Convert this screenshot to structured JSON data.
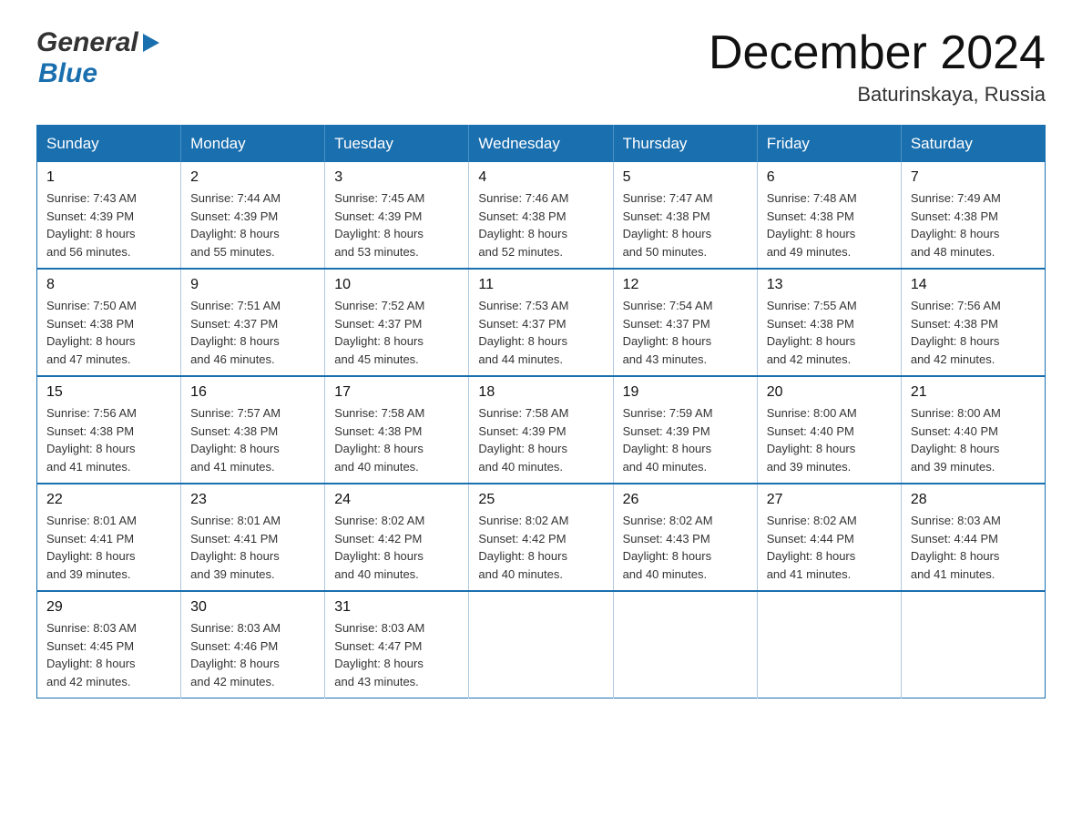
{
  "header": {
    "logo_general": "General",
    "logo_blue": "Blue",
    "month_title": "December 2024",
    "location": "Baturinskaya, Russia"
  },
  "days_of_week": [
    "Sunday",
    "Monday",
    "Tuesday",
    "Wednesday",
    "Thursday",
    "Friday",
    "Saturday"
  ],
  "weeks": [
    [
      {
        "day": "1",
        "sunrise": "7:43 AM",
        "sunset": "4:39 PM",
        "daylight": "8 hours and 56 minutes."
      },
      {
        "day": "2",
        "sunrise": "7:44 AM",
        "sunset": "4:39 PM",
        "daylight": "8 hours and 55 minutes."
      },
      {
        "day": "3",
        "sunrise": "7:45 AM",
        "sunset": "4:39 PM",
        "daylight": "8 hours and 53 minutes."
      },
      {
        "day": "4",
        "sunrise": "7:46 AM",
        "sunset": "4:38 PM",
        "daylight": "8 hours and 52 minutes."
      },
      {
        "day": "5",
        "sunrise": "7:47 AM",
        "sunset": "4:38 PM",
        "daylight": "8 hours and 50 minutes."
      },
      {
        "day": "6",
        "sunrise": "7:48 AM",
        "sunset": "4:38 PM",
        "daylight": "8 hours and 49 minutes."
      },
      {
        "day": "7",
        "sunrise": "7:49 AM",
        "sunset": "4:38 PM",
        "daylight": "8 hours and 48 minutes."
      }
    ],
    [
      {
        "day": "8",
        "sunrise": "7:50 AM",
        "sunset": "4:38 PM",
        "daylight": "8 hours and 47 minutes."
      },
      {
        "day": "9",
        "sunrise": "7:51 AM",
        "sunset": "4:37 PM",
        "daylight": "8 hours and 46 minutes."
      },
      {
        "day": "10",
        "sunrise": "7:52 AM",
        "sunset": "4:37 PM",
        "daylight": "8 hours and 45 minutes."
      },
      {
        "day": "11",
        "sunrise": "7:53 AM",
        "sunset": "4:37 PM",
        "daylight": "8 hours and 44 minutes."
      },
      {
        "day": "12",
        "sunrise": "7:54 AM",
        "sunset": "4:37 PM",
        "daylight": "8 hours and 43 minutes."
      },
      {
        "day": "13",
        "sunrise": "7:55 AM",
        "sunset": "4:38 PM",
        "daylight": "8 hours and 42 minutes."
      },
      {
        "day": "14",
        "sunrise": "7:56 AM",
        "sunset": "4:38 PM",
        "daylight": "8 hours and 42 minutes."
      }
    ],
    [
      {
        "day": "15",
        "sunrise": "7:56 AM",
        "sunset": "4:38 PM",
        "daylight": "8 hours and 41 minutes."
      },
      {
        "day": "16",
        "sunrise": "7:57 AM",
        "sunset": "4:38 PM",
        "daylight": "8 hours and 41 minutes."
      },
      {
        "day": "17",
        "sunrise": "7:58 AM",
        "sunset": "4:38 PM",
        "daylight": "8 hours and 40 minutes."
      },
      {
        "day": "18",
        "sunrise": "7:58 AM",
        "sunset": "4:39 PM",
        "daylight": "8 hours and 40 minutes."
      },
      {
        "day": "19",
        "sunrise": "7:59 AM",
        "sunset": "4:39 PM",
        "daylight": "8 hours and 40 minutes."
      },
      {
        "day": "20",
        "sunrise": "8:00 AM",
        "sunset": "4:40 PM",
        "daylight": "8 hours and 39 minutes."
      },
      {
        "day": "21",
        "sunrise": "8:00 AM",
        "sunset": "4:40 PM",
        "daylight": "8 hours and 39 minutes."
      }
    ],
    [
      {
        "day": "22",
        "sunrise": "8:01 AM",
        "sunset": "4:41 PM",
        "daylight": "8 hours and 39 minutes."
      },
      {
        "day": "23",
        "sunrise": "8:01 AM",
        "sunset": "4:41 PM",
        "daylight": "8 hours and 39 minutes."
      },
      {
        "day": "24",
        "sunrise": "8:02 AM",
        "sunset": "4:42 PM",
        "daylight": "8 hours and 40 minutes."
      },
      {
        "day": "25",
        "sunrise": "8:02 AM",
        "sunset": "4:42 PM",
        "daylight": "8 hours and 40 minutes."
      },
      {
        "day": "26",
        "sunrise": "8:02 AM",
        "sunset": "4:43 PM",
        "daylight": "8 hours and 40 minutes."
      },
      {
        "day": "27",
        "sunrise": "8:02 AM",
        "sunset": "4:44 PM",
        "daylight": "8 hours and 41 minutes."
      },
      {
        "day": "28",
        "sunrise": "8:03 AM",
        "sunset": "4:44 PM",
        "daylight": "8 hours and 41 minutes."
      }
    ],
    [
      {
        "day": "29",
        "sunrise": "8:03 AM",
        "sunset": "4:45 PM",
        "daylight": "8 hours and 42 minutes."
      },
      {
        "day": "30",
        "sunrise": "8:03 AM",
        "sunset": "4:46 PM",
        "daylight": "8 hours and 42 minutes."
      },
      {
        "day": "31",
        "sunrise": "8:03 AM",
        "sunset": "4:47 PM",
        "daylight": "8 hours and 43 minutes."
      },
      null,
      null,
      null,
      null
    ]
  ],
  "labels": {
    "sunrise": "Sunrise:",
    "sunset": "Sunset:",
    "daylight": "Daylight:"
  }
}
